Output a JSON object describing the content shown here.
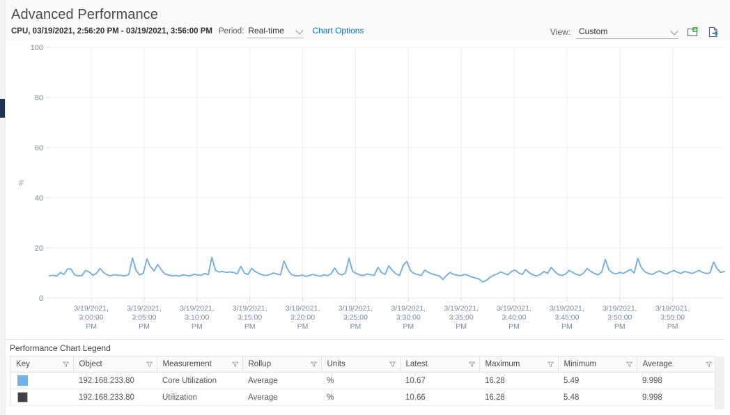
{
  "header": {
    "title": "Advanced Performance",
    "range_text": "CPU, 03/19/2021, 2:56:20 PM - 03/19/2021, 3:56:00 PM",
    "period_label": "Period:",
    "period_value": "Real-time",
    "chart_options_link": "Chart Options",
    "view_label": "View:",
    "view_value": "Custom",
    "save_view_icon": "save-view-icon",
    "export_icon": "export-icon"
  },
  "legend": {
    "title": "Performance Chart Legend",
    "columns": [
      {
        "label": "Key",
        "filter_icon": "filter-funnel-icon"
      },
      {
        "label": "Object",
        "filter_icon": "filter-funnel-icon"
      },
      {
        "label": "Measurement",
        "filter_icon": "filter-funnel-icon"
      },
      {
        "label": "Rollup",
        "filter_icon": "filter-funnel-icon"
      },
      {
        "label": "Units",
        "filter_icon": "filter-funnel-icon"
      },
      {
        "label": "Latest",
        "filter_icon": "filter-funnel-icon"
      },
      {
        "label": "Maximum",
        "filter_icon": "filter-funnel-icon"
      },
      {
        "label": "Minimum",
        "filter_icon": "filter-funnel-icon"
      },
      {
        "label": "Average",
        "filter_icon": "filter-funnel-icon"
      }
    ],
    "rows": [
      {
        "key_color": "#6fb3ec",
        "object": "192.168.233.80",
        "measurement": "Core Utilization",
        "rollup": "Average",
        "units": "%",
        "latest": "10.67",
        "maximum": "16.28",
        "minimum": "5.49",
        "average": "9.998"
      },
      {
        "key_color": "#414047",
        "object": "192.168.233.80",
        "measurement": "Utilization",
        "rollup": "Average",
        "units": "%",
        "latest": "10.66",
        "maximum": "16.28",
        "minimum": "5.48",
        "average": "9.998"
      }
    ]
  },
  "chart_data": {
    "type": "line",
    "title": "",
    "xlabel": "",
    "ylabel": "%",
    "ylim": [
      0,
      100
    ],
    "yticks": [
      0,
      20,
      40,
      60,
      80,
      100
    ],
    "grid": true,
    "legend_position": "below-table",
    "xticks": [
      "3/19/2021, 3:00:00 PM",
      "3/19/2021, 3:05:00 PM",
      "3/19/2021, 3:10:00 PM",
      "3/19/2021, 3:15:00 PM",
      "3/19/2021, 3:20:00 PM",
      "3/19/2021, 3:25:00 PM",
      "3/19/2021, 3:30:00 PM",
      "3/19/2021, 3:35:00 PM",
      "3/19/2021, 3:40:00 PM",
      "3/19/2021, 3:45:00 PM",
      "3/19/2021, 3:50:00 PM",
      "3/19/2021, 3:55:00 PM"
    ],
    "xlim": [
      "3/19/2021, 2:56:20 PM",
      "3/19/2021, 3:56:00 PM"
    ],
    "series": [
      {
        "name": "192.168.233.80 Core Utilization",
        "color": "#6fb3ec",
        "units": "%",
        "values": [
          8.9,
          9.1,
          8.7,
          10.2,
          9.4,
          11.6,
          11.5,
          9.2,
          8.8,
          9.0,
          11.0,
          10.4,
          9.1,
          9.8,
          11.8,
          10.2,
          9.2,
          8.9,
          9.3,
          9.1,
          9.0,
          8.8,
          9.4,
          16.0,
          11.0,
          9.2,
          9.9,
          15.6,
          12.4,
          10.8,
          13.4,
          11.2,
          9.6,
          9.2,
          8.8,
          9.0,
          8.7,
          9.2,
          9.0,
          8.8,
          9.5,
          9.2,
          9.0,
          9.8,
          9.3,
          16.2,
          11.0,
          10.4,
          10.6,
          10.2,
          10.4,
          10.2,
          9.6,
          12.6,
          10.0,
          9.4,
          11.8,
          10.6,
          9.8,
          9.2,
          9.0,
          9.3,
          10.0,
          9.6,
          9.2,
          14.8,
          11.4,
          9.4,
          8.9,
          8.8,
          9.2,
          8.6,
          9.0,
          9.4,
          9.0,
          8.7,
          9.2,
          8.9,
          9.6,
          12.0,
          9.8,
          9.2,
          10.0,
          15.8,
          10.6,
          9.8,
          9.2,
          9.0,
          9.6,
          9.3,
          9.0,
          12.2,
          10.2,
          9.4,
          12.8,
          11.0,
          9.6,
          9.0,
          13.0,
          14.6,
          11.0,
          9.8,
          9.4,
          9.0,
          11.2,
          10.2,
          9.6,
          9.2,
          8.8,
          7.4,
          9.0,
          10.2,
          9.4,
          9.1,
          8.9,
          9.4,
          9.0,
          8.4,
          8.0,
          7.6,
          6.4,
          7.0,
          8.2,
          9.0,
          9.6,
          10.4,
          9.8,
          9.2,
          10.6,
          11.2,
          10.0,
          9.4,
          11.4,
          10.0,
          9.2,
          8.8,
          9.4,
          10.6,
          9.8,
          12.2,
          10.6,
          9.4,
          9.0,
          9.6,
          11.0,
          10.2,
          9.4,
          9.0,
          10.0,
          11.8,
          10.6,
          9.8,
          9.2,
          10.4,
          15.4,
          11.2,
          10.0,
          9.6,
          10.2,
          9.8,
          10.6,
          11.4,
          10.0,
          15.8,
          12.0,
          10.4,
          9.8,
          9.4,
          10.2,
          10.8,
          10.0,
          9.6,
          10.4,
          11.0,
          10.2,
          9.8,
          10.6,
          10.2,
          9.8,
          10.4,
          11.0,
          10.2,
          9.8,
          10.0,
          14.4,
          11.6,
          10.2,
          10.67
        ]
      },
      {
        "name": "192.168.233.80 Utilization",
        "color": "#414047",
        "units": "%",
        "note": "overlaps-core-utilization",
        "values": [
          8.9,
          9.1,
          8.7,
          10.2,
          9.4,
          11.6,
          11.5,
          9.2,
          8.8,
          9.0,
          11.0,
          10.4,
          9.1,
          9.8,
          11.8,
          10.2,
          9.2,
          8.9,
          9.3,
          9.1,
          9.0,
          8.8,
          9.4,
          16.0,
          11.0,
          9.2,
          9.9,
          15.6,
          12.4,
          10.8,
          13.4,
          11.2,
          9.6,
          9.2,
          8.8,
          9.0,
          8.7,
          9.2,
          9.0,
          8.8,
          9.5,
          9.2,
          9.0,
          9.8,
          9.3,
          16.2,
          11.0,
          10.4,
          10.6,
          10.2,
          10.4,
          10.2,
          9.6,
          12.6,
          10.0,
          9.4,
          11.8,
          10.6,
          9.8,
          9.2,
          9.0,
          9.3,
          10.0,
          9.6,
          9.2,
          14.8,
          11.4,
          9.4,
          8.9,
          8.8,
          9.2,
          8.6,
          9.0,
          9.4,
          9.0,
          8.7,
          9.2,
          8.9,
          9.6,
          12.0,
          9.8,
          9.2,
          10.0,
          15.8,
          10.6,
          9.8,
          9.2,
          9.0,
          9.6,
          9.3,
          9.0,
          12.2,
          10.2,
          9.4,
          12.8,
          11.0,
          9.6,
          9.0,
          13.0,
          14.6,
          11.0,
          9.8,
          9.4,
          9.0,
          11.2,
          10.2,
          9.6,
          9.2,
          8.8,
          7.4,
          9.0,
          10.2,
          9.4,
          9.1,
          8.9,
          9.4,
          9.0,
          8.4,
          8.0,
          7.6,
          6.4,
          7.0,
          8.2,
          9.0,
          9.6,
          10.4,
          9.8,
          9.2,
          10.6,
          11.2,
          10.0,
          9.4,
          11.4,
          10.0,
          9.2,
          8.8,
          9.4,
          10.6,
          9.8,
          12.2,
          10.6,
          9.4,
          9.0,
          9.6,
          11.0,
          10.2,
          9.4,
          9.0,
          10.0,
          11.8,
          10.6,
          9.8,
          9.2,
          10.4,
          15.4,
          11.2,
          10.0,
          9.6,
          10.2,
          9.8,
          10.6,
          11.4,
          10.0,
          15.8,
          12.0,
          10.4,
          9.8,
          9.4,
          10.2,
          10.8,
          10.0,
          9.6,
          10.4,
          11.0,
          10.2,
          9.8,
          10.6,
          10.2,
          9.8,
          10.4,
          11.0,
          10.2,
          9.8,
          10.0,
          14.4,
          11.6,
          10.2,
          10.66
        ]
      }
    ]
  }
}
